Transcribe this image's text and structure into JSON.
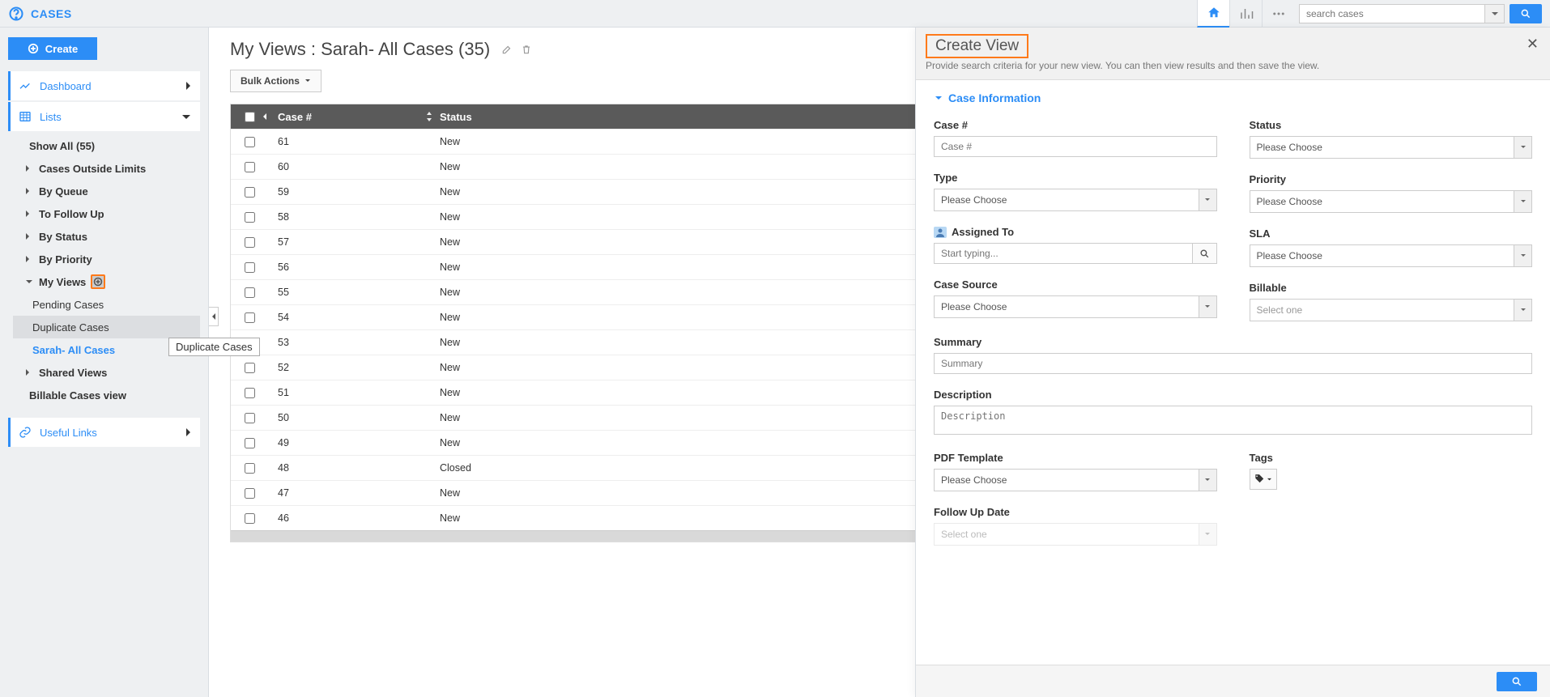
{
  "brand": "CASES",
  "search": {
    "placeholder": "search cases"
  },
  "sidebar": {
    "create": "Create",
    "dashboard": "Dashboard",
    "lists": "Lists",
    "items": [
      {
        "label": "Show All (55)"
      },
      {
        "label": "Cases Outside Limits"
      },
      {
        "label": "By Queue"
      },
      {
        "label": "To Follow Up"
      },
      {
        "label": "By Status"
      },
      {
        "label": "By Priority"
      },
      {
        "label": "My Views"
      },
      {
        "label": "Pending Cases"
      },
      {
        "label": "Duplicate Cases"
      },
      {
        "label": "Sarah- All Cases"
      },
      {
        "label": "Shared Views"
      },
      {
        "label": "Billable Cases view"
      }
    ],
    "useful_links": "Useful Links",
    "tooltip": "Duplicate Cases"
  },
  "main": {
    "title": "My Views : Sarah- All Cases (35)",
    "bulk": "Bulk Actions",
    "cols": {
      "case": "Case #",
      "status": "Status"
    },
    "rows": [
      {
        "case": "61",
        "status": "New"
      },
      {
        "case": "60",
        "status": "New"
      },
      {
        "case": "59",
        "status": "New"
      },
      {
        "case": "58",
        "status": "New"
      },
      {
        "case": "57",
        "status": "New"
      },
      {
        "case": "56",
        "status": "New"
      },
      {
        "case": "55",
        "status": "New"
      },
      {
        "case": "54",
        "status": "New"
      },
      {
        "case": "53",
        "status": "New"
      },
      {
        "case": "52",
        "status": "New"
      },
      {
        "case": "51",
        "status": "New"
      },
      {
        "case": "50",
        "status": "New"
      },
      {
        "case": "49",
        "status": "New"
      },
      {
        "case": "48",
        "status": "Closed"
      },
      {
        "case": "47",
        "status": "New"
      },
      {
        "case": "46",
        "status": "New"
      }
    ]
  },
  "panel": {
    "title": "Create View",
    "subtitle": "Provide search criteria for your new view. You can then view results and then save the view.",
    "section": "Case Information",
    "labels": {
      "case_no": "Case #",
      "status": "Status",
      "type": "Type",
      "priority": "Priority",
      "assigned": "Assigned To",
      "sla": "SLA",
      "source": "Case Source",
      "billable": "Billable",
      "summary": "Summary",
      "description": "Description",
      "pdf": "PDF Template",
      "tags": "Tags",
      "followup": "Follow Up Date"
    },
    "ph": {
      "case_no": "Case #",
      "choose": "Please Choose",
      "assigned": "Start typing...",
      "select_one": "Select one",
      "summary": "Summary",
      "description": "Description"
    }
  }
}
